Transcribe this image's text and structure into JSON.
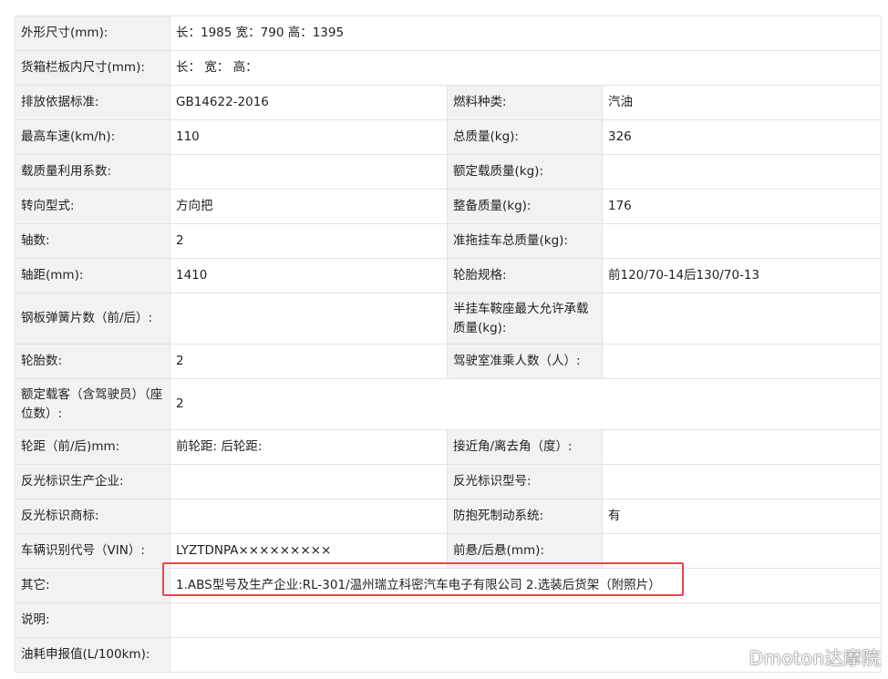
{
  "rows": [
    {
      "l1": "外形尺寸(mm):",
      "v1": "长：1985 宽：790 高：1395"
    },
    {
      "l1": "货箱栏板内尺寸(mm):",
      "v1": "长：  宽：  高："
    },
    {
      "l1": "排放依据标准:",
      "v1": "GB14622-2016",
      "l2": "燃料种类:",
      "v2": "汽油"
    },
    {
      "l1": "最高车速(km/h):",
      "v1": "110",
      "l2": "总质量(kg):",
      "v2": "326"
    },
    {
      "l1": "载质量利用系数:",
      "v1": "",
      "l2": "额定载质量(kg):",
      "v2": ""
    },
    {
      "l1": "转向型式:",
      "v1": "方向把",
      "l2": "整备质量(kg):",
      "v2": "176"
    },
    {
      "l1": "轴数:",
      "v1": "2",
      "l2": "准拖挂车总质量(kg):",
      "v2": ""
    },
    {
      "l1": "轴距(mm):",
      "v1": "1410",
      "l2": "轮胎规格:",
      "v2": "前120/70-14后130/70-13"
    },
    {
      "l1": "钢板弹簧片数（前/后）:",
      "v1": "",
      "l2": "半挂车鞍座最大允许承载质量(kg):",
      "v2": ""
    },
    {
      "l1": "轮胎数:",
      "v1": "2",
      "l2": "驾驶室准乘人数（人）:",
      "v2": ""
    },
    {
      "l1": "额定载客（含驾驶员）（座位数）:",
      "v1": "2"
    },
    {
      "l1": "轮距（前/后)mm:",
      "v1": "前轮距: 后轮距:",
      "l2": "接近角/离去角（度）:",
      "v2": ""
    },
    {
      "l1": "反光标识生产企业:",
      "v1": "",
      "l2": "反光标识型号:",
      "v2": ""
    },
    {
      "l1": "反光标识商标:",
      "v1": "",
      "l2": "防抱死制动系统:",
      "v2": "有"
    },
    {
      "l1": "车辆识别代号（VIN）:",
      "v1": "LYZTDNPA×××××××××",
      "l2": "前悬/后悬(mm):",
      "v2": ""
    },
    {
      "l1": "其它:",
      "v1": "1.ABS型号及生产企业:RL-301/温州瑞立科密汽车电子有限公司 2.选装后货架（附照片）"
    },
    {
      "l1": "说明:",
      "v1": ""
    },
    {
      "l1": "油耗申报值(L/100km):",
      "v1": ""
    }
  ],
  "watermark": "Dmoton达摩院",
  "colors": {
    "label_bg": "#f2f2f2",
    "border": "#e3e3e3",
    "highlight": "#e24a4a"
  }
}
